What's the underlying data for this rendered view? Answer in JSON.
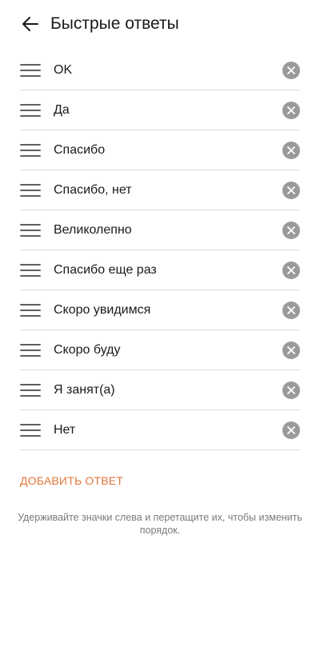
{
  "header": {
    "title": "Быстрые ответы",
    "back_icon": "arrow-left-icon"
  },
  "replies": [
    {
      "label": "OK"
    },
    {
      "label": "Да"
    },
    {
      "label": "Спасибо"
    },
    {
      "label": "Спасибо, нет"
    },
    {
      "label": "Великолепно"
    },
    {
      "label": "Спасибо еще раз"
    },
    {
      "label": "Скоро увидимся"
    },
    {
      "label": "Скоро буду"
    },
    {
      "label": "Я занят(а)"
    },
    {
      "label": "Нет"
    }
  ],
  "row_icons": {
    "drag": "drag-handle-icon",
    "remove": "remove-circle-x-icon"
  },
  "add_button": {
    "label": "ДОБАВИТЬ ОТВЕТ"
  },
  "hint": {
    "text": "Удерживайте значки слева и перетащите их, чтобы изменить порядок."
  },
  "colors": {
    "accent": "#e2763a",
    "text": "#1a1a1a",
    "secondary_text": "#7a7a7a",
    "remove_icon_bg": "#9a9a9a",
    "divider": "#dcdcdc"
  }
}
